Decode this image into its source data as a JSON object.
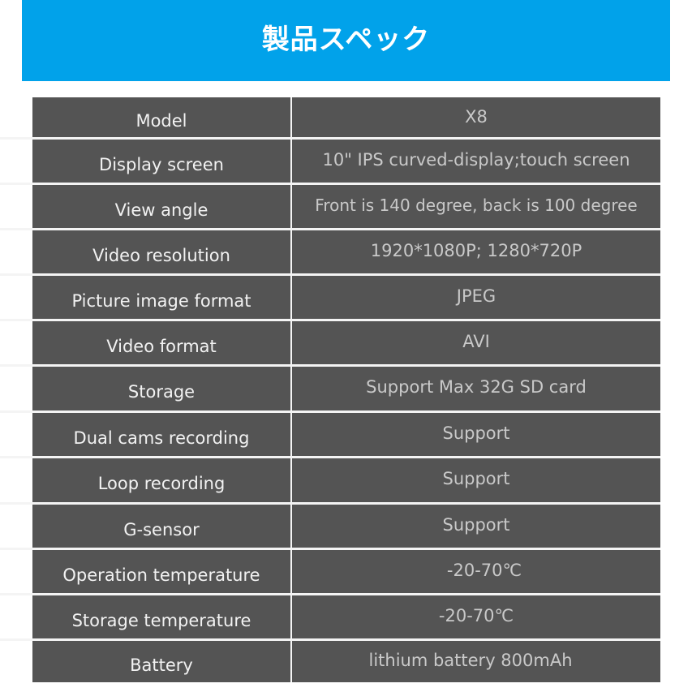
{
  "banner": {
    "title": "製品スペック",
    "color": "#01a2ea"
  },
  "table": {
    "background_color": "#545454",
    "rows": [
      {
        "label": "Model",
        "value": "X8"
      },
      {
        "label": "Display screen",
        "value": "10\" IPS curved-display;touch screen"
      },
      {
        "label": "View angle",
        "value": "Front is 140 degree, back is 100 degree"
      },
      {
        "label": "Video resolution",
        "value": "1920*1080P; 1280*720P"
      },
      {
        "label": "Picture image format",
        "value": "JPEG"
      },
      {
        "label": "Video format",
        "value": "AVI"
      },
      {
        "label": "Storage",
        "value": "Support Max 32G SD card"
      },
      {
        "label": "Dual cams recording",
        "value": "Support"
      },
      {
        "label": "Loop recording",
        "value": "Support"
      },
      {
        "label": "G-sensor",
        "value": "Support"
      },
      {
        "label": "Operation temperature",
        "value": "-20-70℃"
      },
      {
        "label": "Storage temperature",
        "value": "-20-70℃"
      },
      {
        "label": "Battery",
        "value": "lithium battery 800mAh"
      }
    ]
  }
}
